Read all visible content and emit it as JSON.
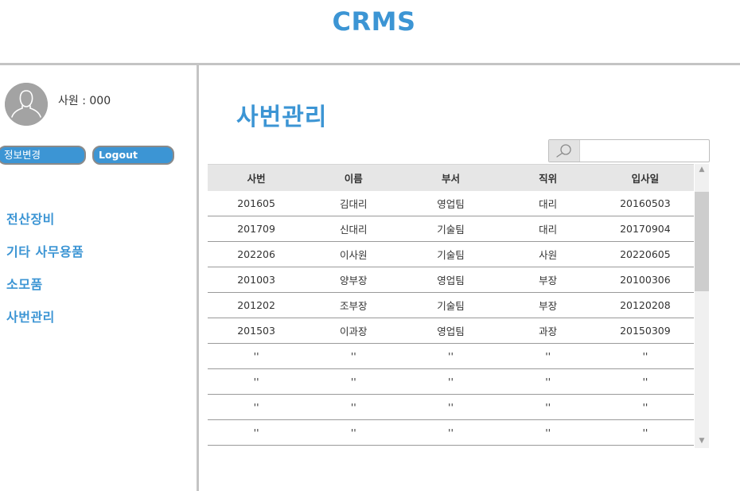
{
  "header": {
    "title": "CRMS"
  },
  "user": {
    "label": "사원 : 000",
    "avatar_icon": "user-avatar-icon"
  },
  "buttons": {
    "info_change": "정보변경",
    "logout": "Logout"
  },
  "nav": {
    "items": [
      {
        "label": "전산장비"
      },
      {
        "label": "기타 사무용품"
      },
      {
        "label": "소모품"
      },
      {
        "label": "사번관리"
      }
    ]
  },
  "main": {
    "heading": "사번관리",
    "search": {
      "placeholder": "",
      "value": "",
      "icon": "search-icon"
    },
    "table": {
      "columns": [
        "사번",
        "이름",
        "부서",
        "직위",
        "입사일"
      ],
      "rows": [
        [
          "201605",
          "김대리",
          "영업팀",
          "대리",
          "20160503"
        ],
        [
          "201709",
          "신대리",
          "기술팀",
          "대리",
          "20170904"
        ],
        [
          "202206",
          "이사원",
          "기술팀",
          "사원",
          "20220605"
        ],
        [
          "201003",
          "양부장",
          "영업팀",
          "부장",
          "20100306"
        ],
        [
          "201202",
          "조부장",
          "기술팀",
          "부장",
          "20120208"
        ],
        [
          "201503",
          "이과장",
          "영업팀",
          "과장",
          "20150309"
        ],
        [
          "''",
          "''",
          "''",
          "''",
          "''"
        ],
        [
          "''",
          "''",
          "''",
          "''",
          "''"
        ],
        [
          "''",
          "''",
          "''",
          "''",
          "''"
        ],
        [
          "''",
          "''",
          "''",
          "''",
          "''"
        ]
      ]
    }
  },
  "colors": {
    "accent": "#3c95d4",
    "divider": "#c4c4c4",
    "header_bg": "#e6e6e6",
    "avatar_bg": "#a3a3a3"
  }
}
